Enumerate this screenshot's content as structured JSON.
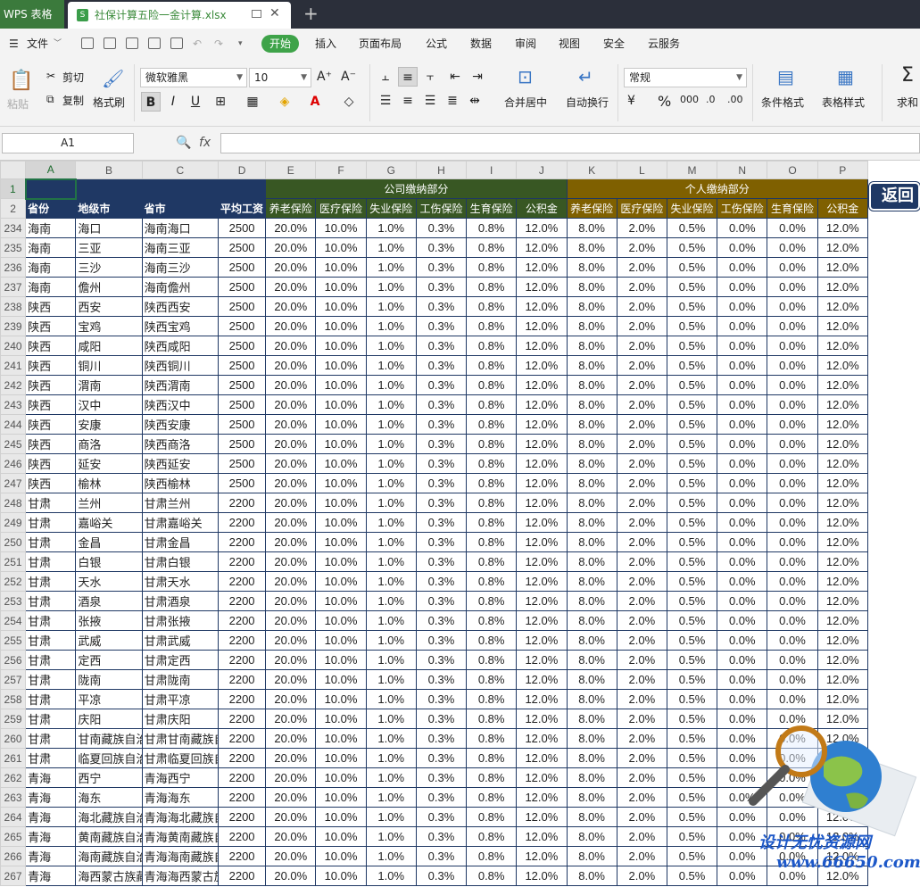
{
  "app": {
    "title": "WPS 表格",
    "file_tab": "社保计算五险一金计算.xlsx",
    "new_tab": "+"
  },
  "menu": {
    "file": "文件",
    "items": [
      "开始",
      "插入",
      "页面布局",
      "公式",
      "数据",
      "审阅",
      "视图",
      "安全",
      "云服务"
    ],
    "active": "开始"
  },
  "ribbon": {
    "paste": "粘贴",
    "cut": "剪切",
    "copy": "复制",
    "format_painter": "格式刷",
    "font_name": "微软雅黑",
    "font_size": "10",
    "merge_center": "合并居中",
    "wrap_text": "自动换行",
    "number_format": "常规",
    "conditional_format": "条件格式",
    "table_style": "表格样式",
    "sum": "求和"
  },
  "formula_bar": {
    "name_box": "A1",
    "fx": "fx",
    "value": ""
  },
  "columns": [
    "A",
    "B",
    "C",
    "D",
    "E",
    "F",
    "G",
    "H",
    "I",
    "J",
    "K",
    "L",
    "M",
    "N",
    "O",
    "P"
  ],
  "header": {
    "company_group": "公司缴纳部分",
    "personal_group": "个人缴纳部分",
    "fields": [
      "省份",
      "地级市",
      "省市",
      "平均工资",
      "养老保险",
      "医疗保险",
      "失业保险",
      "工伤保险",
      "生育保险",
      "公积金",
      "养老保险",
      "医疗保险",
      "失业保险",
      "工伤保险",
      "生育保险",
      "公积金"
    ]
  },
  "rates": [
    "20.0%",
    "10.0%",
    "1.0%",
    "0.3%",
    "0.8%",
    "12.0%",
    "8.0%",
    "2.0%",
    "0.5%",
    "0.0%",
    "0.0%",
    "12.0%"
  ],
  "rows": [
    {
      "n": "234",
      "p": "海南",
      "city": "海口",
      "pc": "海南海口",
      "wage": "2500"
    },
    {
      "n": "235",
      "p": "海南",
      "city": "三亚",
      "pc": "海南三亚",
      "wage": "2500"
    },
    {
      "n": "236",
      "p": "海南",
      "city": "三沙",
      "pc": "海南三沙",
      "wage": "2500"
    },
    {
      "n": "237",
      "p": "海南",
      "city": "儋州",
      "pc": "海南儋州",
      "wage": "2500"
    },
    {
      "n": "238",
      "p": "陕西",
      "city": "西安",
      "pc": "陕西西安",
      "wage": "2500"
    },
    {
      "n": "239",
      "p": "陕西",
      "city": "宝鸡",
      "pc": "陕西宝鸡",
      "wage": "2500"
    },
    {
      "n": "240",
      "p": "陕西",
      "city": "咸阳",
      "pc": "陕西咸阳",
      "wage": "2500"
    },
    {
      "n": "241",
      "p": "陕西",
      "city": "铜川",
      "pc": "陕西铜川",
      "wage": "2500"
    },
    {
      "n": "242",
      "p": "陕西",
      "city": "渭南",
      "pc": "陕西渭南",
      "wage": "2500"
    },
    {
      "n": "243",
      "p": "陕西",
      "city": "汉中",
      "pc": "陕西汉中",
      "wage": "2500"
    },
    {
      "n": "244",
      "p": "陕西",
      "city": "安康",
      "pc": "陕西安康",
      "wage": "2500"
    },
    {
      "n": "245",
      "p": "陕西",
      "city": "商洛",
      "pc": "陕西商洛",
      "wage": "2500"
    },
    {
      "n": "246",
      "p": "陕西",
      "city": "延安",
      "pc": "陕西延安",
      "wage": "2500"
    },
    {
      "n": "247",
      "p": "陕西",
      "city": "榆林",
      "pc": "陕西榆林",
      "wage": "2500"
    },
    {
      "n": "248",
      "p": "甘肃",
      "city": "兰州",
      "pc": "甘肃兰州",
      "wage": "2200"
    },
    {
      "n": "249",
      "p": "甘肃",
      "city": "嘉峪关",
      "pc": "甘肃嘉峪关",
      "wage": "2200"
    },
    {
      "n": "250",
      "p": "甘肃",
      "city": "金昌",
      "pc": "甘肃金昌",
      "wage": "2200"
    },
    {
      "n": "251",
      "p": "甘肃",
      "city": "白银",
      "pc": "甘肃白银",
      "wage": "2200"
    },
    {
      "n": "252",
      "p": "甘肃",
      "city": "天水",
      "pc": "甘肃天水",
      "wage": "2200"
    },
    {
      "n": "253",
      "p": "甘肃",
      "city": "酒泉",
      "pc": "甘肃酒泉",
      "wage": "2200"
    },
    {
      "n": "254",
      "p": "甘肃",
      "city": "张掖",
      "pc": "甘肃张掖",
      "wage": "2200"
    },
    {
      "n": "255",
      "p": "甘肃",
      "city": "武威",
      "pc": "甘肃武威",
      "wage": "2200"
    },
    {
      "n": "256",
      "p": "甘肃",
      "city": "定西",
      "pc": "甘肃定西",
      "wage": "2200"
    },
    {
      "n": "257",
      "p": "甘肃",
      "city": "陇南",
      "pc": "甘肃陇南",
      "wage": "2200"
    },
    {
      "n": "258",
      "p": "甘肃",
      "city": "平凉",
      "pc": "甘肃平凉",
      "wage": "2200"
    },
    {
      "n": "259",
      "p": "甘肃",
      "city": "庆阳",
      "pc": "甘肃庆阳",
      "wage": "2200"
    },
    {
      "n": "260",
      "p": "甘肃",
      "city": "甘南藏族自治",
      "pc": "甘肃甘南藏族自",
      "wage": "2200"
    },
    {
      "n": "261",
      "p": "甘肃",
      "city": "临夏回族自治",
      "pc": "甘肃临夏回族自",
      "wage": "2200"
    },
    {
      "n": "262",
      "p": "青海",
      "city": "西宁",
      "pc": "青海西宁",
      "wage": "2200"
    },
    {
      "n": "263",
      "p": "青海",
      "city": "海东",
      "pc": "青海海东",
      "wage": "2200"
    },
    {
      "n": "264",
      "p": "青海",
      "city": "海北藏族自治",
      "pc": "青海海北藏族自",
      "wage": "2200"
    },
    {
      "n": "265",
      "p": "青海",
      "city": "黄南藏族自治",
      "pc": "青海黄南藏族自",
      "wage": "2200"
    },
    {
      "n": "266",
      "p": "青海",
      "city": "海南藏族自治",
      "pc": "青海海南藏族自",
      "wage": "2200"
    },
    {
      "n": "267",
      "p": "青海",
      "city": "海西蒙古族藏",
      "pc": "青海海西蒙古族",
      "wage": "2200"
    }
  ],
  "back_button": "返回",
  "watermark": {
    "text": "设计无忧资源网",
    "url": "www.66650.com"
  },
  "colors": {
    "header_dark": "#1f3864",
    "header_green": "#385723",
    "header_gold": "#7f6000",
    "accent": "#3ea349"
  }
}
